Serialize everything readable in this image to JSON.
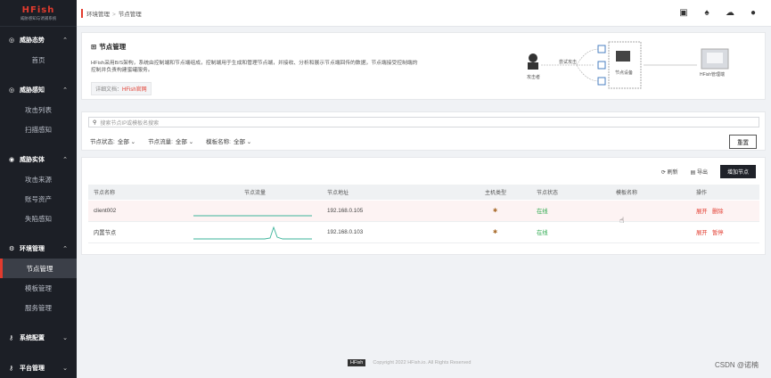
{
  "sidebar": {
    "logo_title": "HFish",
    "logo_sub": "威胁感知与诱捕系统",
    "sections": [
      {
        "label": "威胁态势",
        "items": [
          "首页"
        ]
      },
      {
        "label": "威胁感知",
        "items": [
          "攻击列表",
          "扫描感知"
        ]
      },
      {
        "label": "威胁实体",
        "items": [
          "攻击来源",
          "账号资产",
          "失陷感知"
        ]
      },
      {
        "label": "环境管理",
        "items": [
          "节点管理",
          "模板管理",
          "服务管理"
        ]
      },
      {
        "label": "系统配置",
        "items": []
      },
      {
        "label": "平台管理",
        "items": []
      }
    ]
  },
  "topbar": {
    "crumb1": "环境管理",
    "sep": ">",
    "crumb2": "节点管理"
  },
  "intro": {
    "title": "节点管理",
    "desc": "HFish采用B/S架构，系统由控制端和节点端组成，控制端用于生成和管理节点端，并接收、分析和展示节点端回传的数据，节点端接受控制端的控制并负责构建蜜罐服务。",
    "doc_label": "详细文档：",
    "doc_link": "HFish官网",
    "diagram": {
      "attacker": "攻击者",
      "attack": "尝试攻击",
      "node": "节点设备",
      "console": "HFish管理端"
    }
  },
  "search": {
    "placeholder": "搜索节点IP或模板名搜索",
    "filters": [
      {
        "label": "节点状态:",
        "value": "全部"
      },
      {
        "label": "节点流量:",
        "value": "全部"
      },
      {
        "label": "模板名称:",
        "value": "全部"
      }
    ],
    "reset": "重置"
  },
  "table": {
    "refresh": "刷新",
    "export": "导出",
    "add": "增加节点",
    "headers": [
      "节点名称",
      "节点流量",
      "节点地址",
      "主机类型",
      "节点状态",
      "模板名称",
      "操作"
    ],
    "rows": [
      {
        "name": "client002",
        "ip": "192.168.0.105",
        "status": "在线",
        "template": "",
        "op1": "展开",
        "op2": "删除"
      },
      {
        "name": "内置节点",
        "ip": "192.168.0.103",
        "status": "在线",
        "template": "",
        "op1": "展开",
        "op2": "暂停"
      }
    ]
  },
  "footer": {
    "brand": "HFish",
    "copy": "Copyright 2022 HFish.io. All Rights Reserved"
  },
  "watermark": "CSDN @诺楠",
  "colors": {
    "accent": "#e23b2e",
    "sidebar": "#1c1f26",
    "online": "#2eaa4f",
    "traffic": "#3bb39a"
  }
}
